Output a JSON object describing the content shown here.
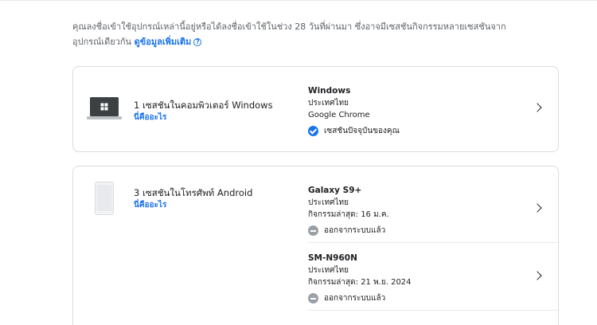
{
  "intro": {
    "text": "คุณลงชื่อเข้าใช้อุปกรณ์เหล่านี้อยู่หรือได้ลงชื่อเข้าใช้ในช่วง 28 วันที่ผ่านมา ซึ่งอาจมีเซสชันกิจกรรมหลายเซสชันจากอุปกรณ์เดียวกัน",
    "link": "ดูข้อมูลเพิ่มเติม",
    "help_icon": "?"
  },
  "groups": [
    {
      "title": "1 เซสชันในคอมพิวเตอร์ Windows",
      "link": "นี่คืออะไร",
      "icon": "laptop-icon",
      "sessions": [
        {
          "name": "Windows",
          "location": "ประเทศไทย",
          "detail": "Google Chrome",
          "status": "เซสชันปัจจุบันของคุณ",
          "status_icon": "check-circle-icon"
        }
      ]
    },
    {
      "title": "3 เซสชันในโทรศัพท์ Android",
      "link": "นี่คืออะไร",
      "icon": "phone-icon",
      "sessions": [
        {
          "name": "Galaxy S9+",
          "location": "ประเทศไทย",
          "detail": "กิจกรรมล่าสุด: 16 ม.ค.",
          "status": "ออกจากระบบแล้ว",
          "status_icon": "minus-circle-icon"
        },
        {
          "name": "SM-N960N",
          "location": "ประเทศไทย",
          "detail": "กิจกรรมล่าสุด: 21 พ.ย. 2024",
          "status": "ออกจากระบบแล้ว",
          "status_icon": "minus-circle-icon"
        }
      ]
    }
  ],
  "colors": {
    "accent": "#1a73e8",
    "border": "#dadce0",
    "signed_out": "#9aa0a6"
  }
}
